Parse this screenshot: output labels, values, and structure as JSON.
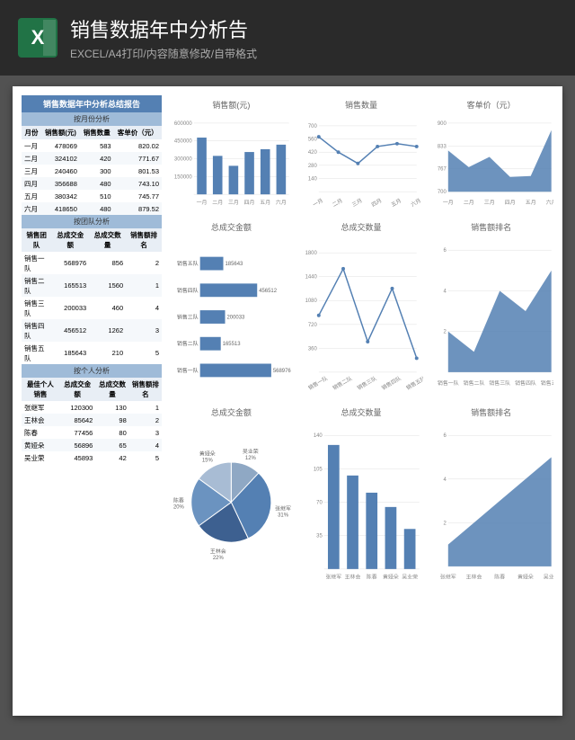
{
  "header": {
    "title": "销售数据年中分析告",
    "subtitle": "EXCEL/A4打印/内容随意修改/自带格式"
  },
  "report_title": "销售数据年中分析总结报告",
  "sections": {
    "monthly": {
      "title": "按月份分析",
      "headers": [
        "月份",
        "销售额(元)",
        "销售数量",
        "客单价（元）"
      ]
    },
    "team": {
      "title": "按团队分析",
      "headers": [
        "销售团队",
        "总成交金额",
        "总成交数量",
        "销售额排名"
      ]
    },
    "individual": {
      "title": "按个人分析",
      "headers": [
        "最佳个人销售",
        "总成交金额",
        "总成交数量",
        "销售额排名"
      ]
    }
  },
  "monthly_data": [
    {
      "m": "一月",
      "s": 478069,
      "q": 583,
      "u": "820.02"
    },
    {
      "m": "二月",
      "s": 324102,
      "q": 420,
      "u": "771.67"
    },
    {
      "m": "三月",
      "s": 240460,
      "q": 300,
      "u": "801.53"
    },
    {
      "m": "四月",
      "s": 356688,
      "q": 480,
      "u": "743.10"
    },
    {
      "m": "五月",
      "s": 380342,
      "q": 510,
      "u": "745.77"
    },
    {
      "m": "六月",
      "s": 418650,
      "q": 480,
      "u": "879.52"
    }
  ],
  "team_data": [
    {
      "n": "销售一队",
      "a": 568976,
      "q": 856,
      "r": 2
    },
    {
      "n": "销售二队",
      "a": 165513,
      "q": 1560,
      "r": 1
    },
    {
      "n": "销售三队",
      "a": 200033,
      "q": 460,
      "r": 4
    },
    {
      "n": "销售四队",
      "a": 456512,
      "q": 1262,
      "r": 3
    },
    {
      "n": "销售五队",
      "a": 185643,
      "q": 210,
      "r": 5
    }
  ],
  "individual_data": [
    {
      "n": "张继军",
      "a": 120300,
      "q": 130,
      "r": 1
    },
    {
      "n": "王林会",
      "a": 85642,
      "q": 98,
      "r": 2
    },
    {
      "n": "陈春",
      "a": 77456,
      "q": 80,
      "r": 3
    },
    {
      "n": "黄娅朵",
      "a": 56896,
      "q": 65,
      "r": 4
    },
    {
      "n": "吴业荣",
      "a": 45893,
      "q": 42,
      "r": 5
    }
  ],
  "chart_titles": {
    "c1": "销售额(元)",
    "c2": "销售数量",
    "c3": "客单价（元）",
    "c4": "总成交金额",
    "c5": "总成交数量",
    "c6": "销售额排名",
    "c7": "总成交金额",
    "c8": "总成交数量",
    "c9": "销售额排名"
  },
  "chart_data": [
    {
      "type": "bar",
      "title": "销售额(元)",
      "categories": [
        "一月",
        "二月",
        "三月",
        "四月",
        "五月",
        "六月"
      ],
      "values": [
        478069,
        324102,
        240460,
        356688,
        380342,
        418650
      ],
      "ylim": [
        0,
        600000
      ]
    },
    {
      "type": "line",
      "title": "销售数量",
      "categories": [
        "一月",
        "二月",
        "三月",
        "四月",
        "五月",
        "六月"
      ],
      "values": [
        583,
        420,
        300,
        480,
        510,
        480
      ],
      "ylim": [
        0,
        700
      ]
    },
    {
      "type": "area",
      "title": "客单价（元）",
      "categories": [
        "一月",
        "二月",
        "三月",
        "四月",
        "五月",
        "六月"
      ],
      "values": [
        820.02,
        771.67,
        801.53,
        743.1,
        745.77,
        879.52
      ],
      "ylim": [
        700,
        900
      ]
    },
    {
      "type": "bar",
      "orientation": "horizontal",
      "title": "总成交金额",
      "categories": [
        "销售五队",
        "销售四队",
        "销售三队",
        "销售二队",
        "销售一队"
      ],
      "values": [
        185643,
        456512,
        200033,
        165513,
        568976
      ]
    },
    {
      "type": "line",
      "title": "总成交数量",
      "categories": [
        "销售一队",
        "销售二队",
        "销售三队",
        "销售四队",
        "销售五队"
      ],
      "values": [
        856,
        1560,
        460,
        1262,
        210
      ],
      "ylim": [
        0,
        1800
      ]
    },
    {
      "type": "area",
      "title": "销售额排名",
      "categories": [
        "销售一队",
        "销售二队",
        "销售三队",
        "销售四队",
        "销售五队"
      ],
      "values": [
        2,
        1,
        4,
        3,
        5
      ],
      "ylim": [
        0,
        6
      ]
    },
    {
      "type": "pie",
      "title": "总成交金额",
      "slices": [
        {
          "name": "吴业荣",
          "value": 12
        },
        {
          "name": "张继军",
          "value": 31
        },
        {
          "name": "王林会",
          "value": 22
        },
        {
          "name": "陈春",
          "value": 20
        },
        {
          "name": "黄娅朵",
          "value": 15
        }
      ]
    },
    {
      "type": "bar",
      "title": "总成交数量",
      "categories": [
        "张继军",
        "王林会",
        "陈春",
        "黄娅朵",
        "吴业荣"
      ],
      "values": [
        130,
        98,
        80,
        65,
        42
      ],
      "ylim": [
        0,
        140
      ]
    },
    {
      "type": "area",
      "title": "销售额排名",
      "categories": [
        "张继军",
        "王林会",
        "陈春",
        "黄娅朵",
        "吴业荣"
      ],
      "values": [
        1,
        2,
        3,
        4,
        5
      ],
      "ylim": [
        0,
        6
      ]
    }
  ]
}
